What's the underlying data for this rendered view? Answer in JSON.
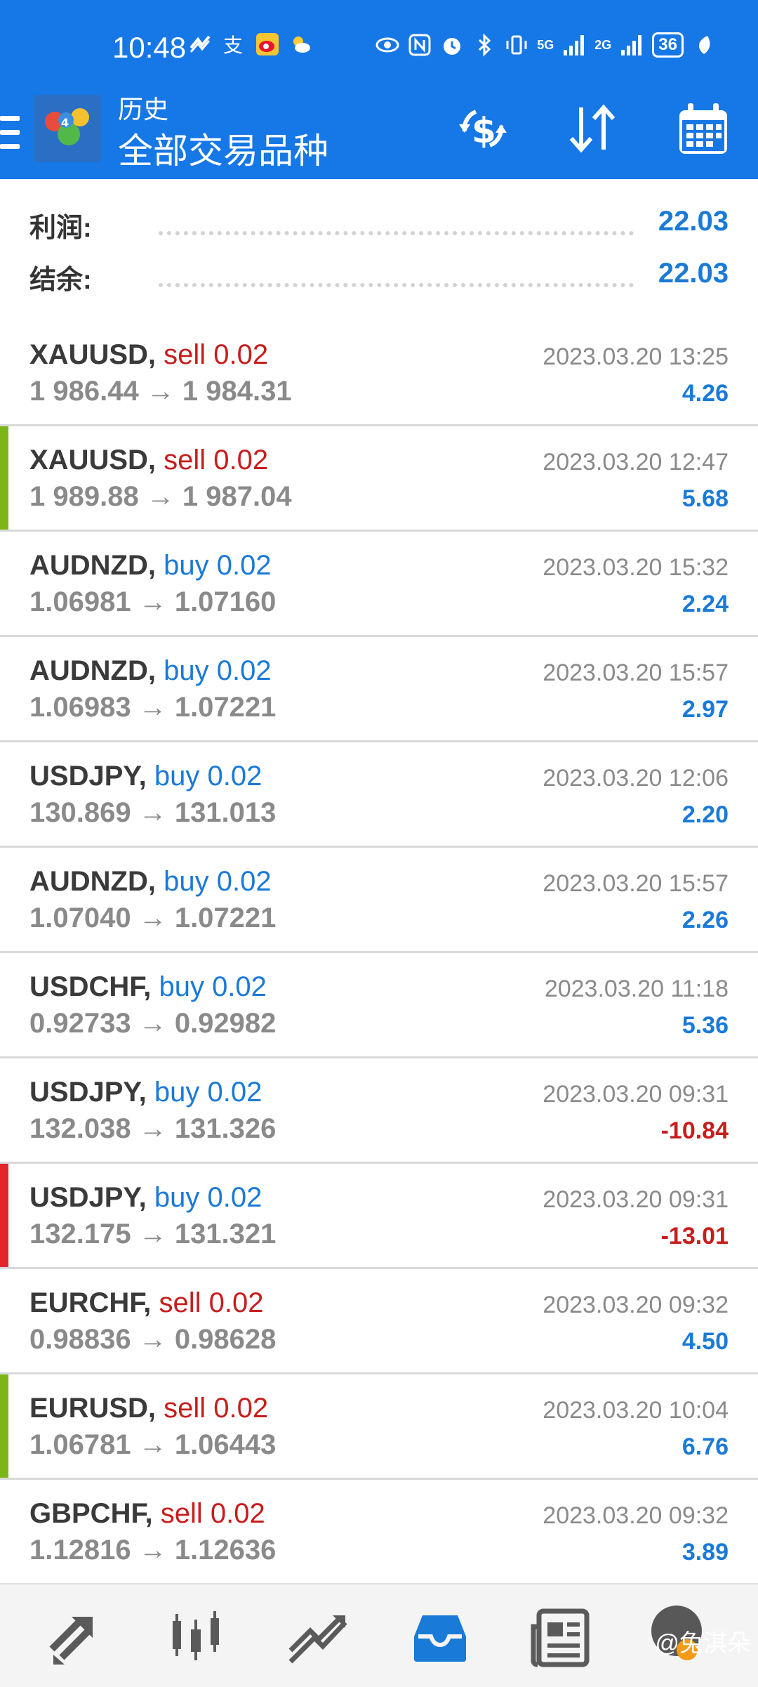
{
  "status_bar": {
    "time": "10:48",
    "icons_left": [
      "data-saver-icon",
      "alipay-icon",
      "weibo-icon",
      "weather-icon"
    ],
    "icons_right": [
      "eye-icon",
      "nfc-icon",
      "alarm-icon",
      "bluetooth-icon",
      "vibrate-icon",
      "signal-5g-icon",
      "signal-2g-icon",
      "battery-icon",
      "leaf-icon"
    ],
    "sim1_label": "5G",
    "sim2_label": "2G",
    "battery": "36"
  },
  "toolbar": {
    "subtitle": "历史",
    "title": "全部交易品种",
    "actions": [
      "currency-exchange-icon",
      "sort-icon",
      "calendar-icon"
    ]
  },
  "summary": {
    "profit_label": "利润:",
    "profit_value": "22.03",
    "balance_label": "结余:",
    "balance_value": "22.03"
  },
  "colors": {
    "brand": "#1677e6",
    "buy": "#1a7ad8",
    "sell": "#c81d1d",
    "flag_green": "#7cb518",
    "flag_red": "#e0262b"
  },
  "trades": [
    {
      "symbol": "XAUUSD,",
      "side": "sell 0.02",
      "prices": "1 986.44 → 1 984.31",
      "time": "2023.03.20 13:25",
      "profit": "4.26",
      "flag": ""
    },
    {
      "symbol": "XAUUSD,",
      "side": "sell 0.02",
      "prices": "1 989.88 → 1 987.04",
      "time": "2023.03.20 12:47",
      "profit": "5.68",
      "flag": "green"
    },
    {
      "symbol": "AUDNZD,",
      "side": "buy 0.02",
      "prices": "1.06981 → 1.07160",
      "time": "2023.03.20 15:32",
      "profit": "2.24",
      "flag": ""
    },
    {
      "symbol": "AUDNZD,",
      "side": "buy 0.02",
      "prices": "1.06983 → 1.07221",
      "time": "2023.03.20 15:57",
      "profit": "2.97",
      "flag": ""
    },
    {
      "symbol": "USDJPY,",
      "side": "buy 0.02",
      "prices": "130.869 → 131.013",
      "time": "2023.03.20 12:06",
      "profit": "2.20",
      "flag": ""
    },
    {
      "symbol": "AUDNZD,",
      "side": "buy 0.02",
      "prices": "1.07040 → 1.07221",
      "time": "2023.03.20 15:57",
      "profit": "2.26",
      "flag": ""
    },
    {
      "symbol": "USDCHF,",
      "side": "buy 0.02",
      "prices": "0.92733 → 0.92982",
      "time": "2023.03.20 11:18",
      "profit": "5.36",
      "flag": ""
    },
    {
      "symbol": "USDJPY,",
      "side": "buy 0.02",
      "prices": "132.038 → 131.326",
      "time": "2023.03.20 09:31",
      "profit": "-10.84",
      "flag": ""
    },
    {
      "symbol": "USDJPY,",
      "side": "buy 0.02",
      "prices": "132.175 → 131.321",
      "time": "2023.03.20 09:31",
      "profit": "-13.01",
      "flag": "red"
    },
    {
      "symbol": "EURCHF,",
      "side": "sell 0.02",
      "prices": "0.98836 → 0.98628",
      "time": "2023.03.20 09:32",
      "profit": "4.50",
      "flag": ""
    },
    {
      "symbol": "EURUSD,",
      "side": "sell 0.02",
      "prices": "1.06781 → 1.06443",
      "time": "2023.03.20 10:04",
      "profit": "6.76",
      "flag": "green"
    },
    {
      "symbol": "GBPCHF,",
      "side": "sell 0.02",
      "prices": "1.12816 → 1.12636",
      "time": "2023.03.20 09:32",
      "profit": "3.89",
      "flag": ""
    }
  ],
  "bottom_nav": {
    "items": [
      "quotes-icon",
      "chart-icon",
      "trade-icon",
      "history-icon",
      "news-icon",
      "chat-icon"
    ],
    "active": "history-icon",
    "watermark": "@兔淇朵"
  }
}
